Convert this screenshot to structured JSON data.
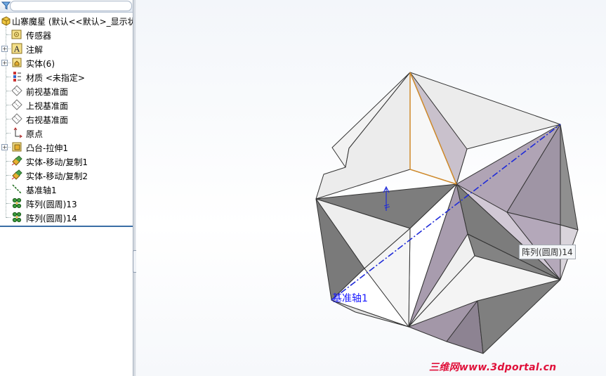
{
  "feature_tree": {
    "root_label": "山寨魔星 (默认<<默认>_显示状",
    "items": [
      {
        "label": "传感器",
        "icon": "sensor-icon",
        "expandable": false
      },
      {
        "label": "注解",
        "icon": "annotation-icon",
        "expandable": true
      },
      {
        "label": "实体(6)",
        "icon": "solid-bodies-icon",
        "expandable": true
      },
      {
        "label": "材质 <未指定>",
        "icon": "material-icon",
        "expandable": false
      },
      {
        "label": "前视基准面",
        "icon": "plane-icon",
        "expandable": false
      },
      {
        "label": "上视基准面",
        "icon": "plane-icon",
        "expandable": false
      },
      {
        "label": "右视基准面",
        "icon": "plane-icon",
        "expandable": false
      },
      {
        "label": "原点",
        "icon": "origin-icon",
        "expandable": false
      },
      {
        "label": "凸台-拉伸1",
        "icon": "extrude-icon",
        "expandable": true
      },
      {
        "label": "实体-移动/复制1",
        "icon": "move-copy-icon",
        "expandable": false
      },
      {
        "label": "实体-移动/复制2",
        "icon": "move-copy-icon",
        "expandable": false
      },
      {
        "label": "基准轴1",
        "icon": "axis-icon",
        "expandable": false
      },
      {
        "label": "阵列(圆周)13",
        "icon": "circular-pattern-icon",
        "expandable": false
      },
      {
        "label": "阵列(圆周)14",
        "icon": "circular-pattern-icon",
        "expandable": false
      }
    ]
  },
  "viewport": {
    "tooltip": "阵列(圆周)14",
    "axis_label": "基准轴1",
    "watermark": "三维网www.3dportal.cn"
  }
}
